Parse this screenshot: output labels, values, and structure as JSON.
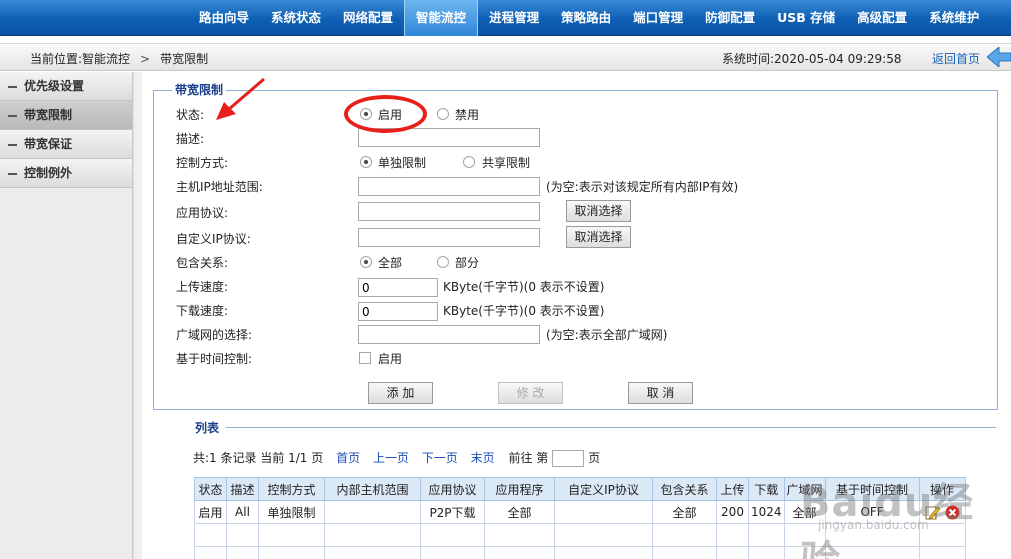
{
  "top_nav": {
    "items": [
      "路由向导",
      "系统状态",
      "网络配置",
      "智能流控",
      "进程管理",
      "策略路由",
      "端口管理",
      "防御配置",
      "USB 存储",
      "高级配置",
      "系统维护"
    ],
    "active_index": 3
  },
  "breadcrumb": {
    "prefix": "当前位置:智能流控",
    "separator": ">",
    "current": "带宽限制",
    "system_time": "系统时间:2020-05-04 09:29:58",
    "home_link": "返回首页"
  },
  "sidebar": {
    "items": [
      "优先级设置",
      "带宽限制",
      "带宽保证",
      "控制例外"
    ],
    "active_index": 1
  },
  "form": {
    "legend": "带宽限制",
    "status": {
      "label": "状态:",
      "option_on": "启用",
      "option_off": "禁用",
      "selected": "启用"
    },
    "description": {
      "label": "描述:",
      "value": ""
    },
    "control_mode": {
      "label": "控制方式:",
      "option_a": "单独限制",
      "option_b": "共享限制",
      "selected": "单独限制"
    },
    "host_ip_range": {
      "label": "主机IP地址范围:",
      "value": "",
      "hint": "(为空:表示对该规定所有内部IP有效)"
    },
    "app_protocol": {
      "label": "应用协议:",
      "value": "",
      "button": "取消选择"
    },
    "custom_ip_protocol": {
      "label": "自定义IP协议:",
      "value": "",
      "button": "取消选择"
    },
    "inclusion": {
      "label": "包含关系:",
      "option_a": "全部",
      "option_b": "部分",
      "selected": "全部"
    },
    "upload_speed": {
      "label": "上传速度:",
      "value": "0",
      "hint": "KByte(千字节)(0 表示不设置)"
    },
    "download_speed": {
      "label": "下载速度:",
      "value": "0",
      "hint": "KByte(千字节)(0 表示不设置)"
    },
    "wan_select": {
      "label": "广域网的选择:",
      "value": "",
      "hint": "(为空:表示全部广域网)"
    },
    "time_control": {
      "label": "基于时间控制:",
      "checkbox_label": "启用",
      "checked": false
    },
    "buttons": {
      "add": "添 加",
      "modify": "修 改",
      "cancel": "取 消"
    }
  },
  "list": {
    "legend": "列表",
    "pager": {
      "summary": "共:1 条记录 当前 1/1 页",
      "first": "首页",
      "prev": "上一页",
      "next": "下一页",
      "last": "末页",
      "goto_prefix": "前往 第",
      "goto_suffix": "页"
    },
    "columns": [
      "状态",
      "描述",
      "控制方式",
      "内部主机范围",
      "应用协议",
      "应用程序",
      "自定义IP协议",
      "包含关系",
      "上传",
      "下载",
      "广域网",
      "基于时间控制",
      "操作"
    ],
    "rows": [
      [
        "启用",
        "All",
        "单独限制",
        "",
        "P2P下载",
        "全部",
        "",
        "全部",
        "200",
        "1024",
        "全部",
        "OFF",
        ""
      ]
    ]
  },
  "watermark": {
    "text": "Baidu经验",
    "sub": "jingyan.baidu.com"
  }
}
